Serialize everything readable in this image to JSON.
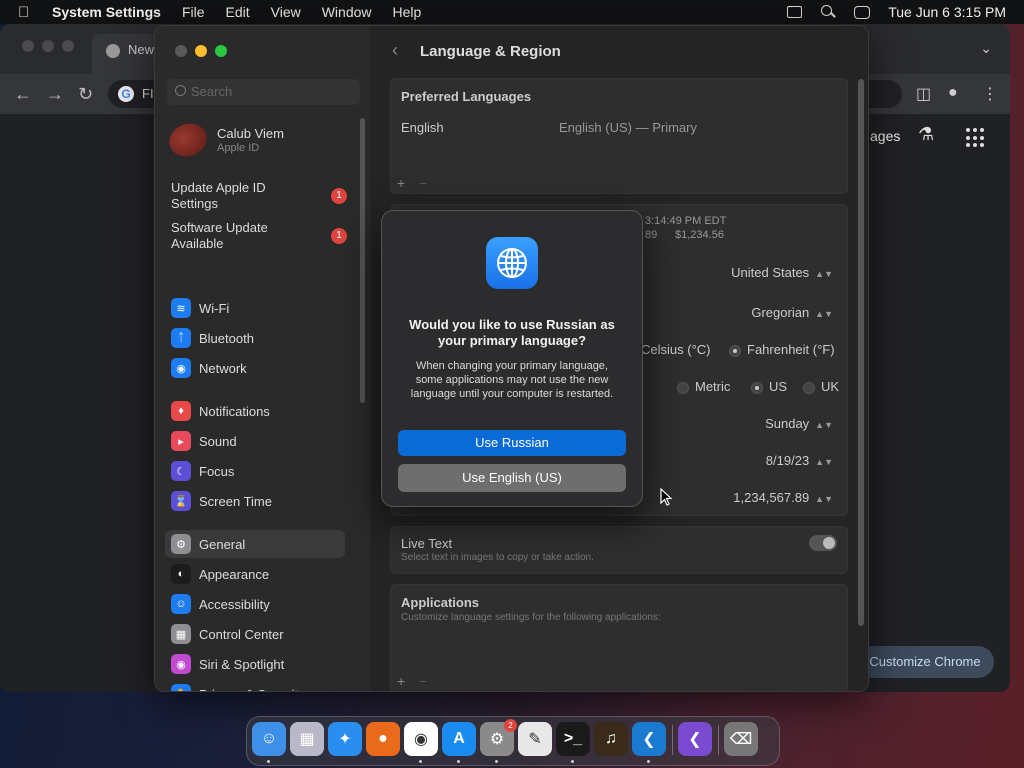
{
  "menubar": {
    "app_name": "System Settings",
    "menus": [
      "File",
      "Edit",
      "View",
      "Window",
      "Help"
    ],
    "clock": "Tue Jun 6  3:15 PM"
  },
  "chrome": {
    "tab_title": "New",
    "omnibox_text": "FI",
    "partial_link": "ages",
    "customize_label": "Customize Chrome"
  },
  "settings": {
    "search_placeholder": "Search",
    "user": {
      "name": "Calub Viem",
      "subtitle": "Apple ID"
    },
    "alerts": [
      {
        "label": "Update Apple ID Settings",
        "count": "1"
      },
      {
        "label": "Software Update Available",
        "count": "1"
      }
    ],
    "sidebar_items": [
      {
        "label": "Wi-Fi",
        "icon": "wifi-icon",
        "color": "#1e7cf2"
      },
      {
        "label": "Bluetooth",
        "icon": "bluetooth-icon",
        "color": "#1e7cf2"
      },
      {
        "label": "Network",
        "icon": "globe-icon",
        "color": "#1e7cf2"
      },
      {
        "label": "Notifications",
        "icon": "bell-icon",
        "color": "#e84a4a"
      },
      {
        "label": "Sound",
        "icon": "speaker-icon",
        "color": "#e84a5c"
      },
      {
        "label": "Focus",
        "icon": "moon-icon",
        "color": "#5b4fd6"
      },
      {
        "label": "Screen Time",
        "icon": "hourglass-icon",
        "color": "#5b4fd6"
      },
      {
        "label": "General",
        "icon": "gear-icon",
        "color": "#8e8e93"
      },
      {
        "label": "Appearance",
        "icon": "appearance-icon",
        "color": "#1c1c1e"
      },
      {
        "label": "Accessibility",
        "icon": "accessibility-icon",
        "color": "#1e7cf2"
      },
      {
        "label": "Control Center",
        "icon": "control-center-icon",
        "color": "#8e8e93"
      },
      {
        "label": "Siri & Spotlight",
        "icon": "siri-icon",
        "color": "#c04ad0"
      },
      {
        "label": "Privacy & Security",
        "icon": "hand-icon",
        "color": "#1e7cf2"
      }
    ],
    "selected_item": "General",
    "page_title": "Language & Region",
    "preferred_languages": {
      "heading": "Preferred Languages",
      "language": "English",
      "value": "English (US) — Primary",
      "add": "+",
      "remove": "−"
    },
    "format_preview": {
      "time": "3:14:49 PM EDT",
      "numbers": "89",
      "currency": "$1,234.56"
    },
    "formats": {
      "region": "United States",
      "calendar": "Gregorian",
      "temp_celsius": "Celsius (°C)",
      "temp_fahrenheit": "Fahrenheit (°F)",
      "measure_metric": "Metric",
      "measure_us": "US",
      "measure_uk": "UK",
      "first_day": "Sunday",
      "date_format": "8/19/23",
      "number_format": "1,234,567.89"
    },
    "live_text": {
      "label": "Live Text",
      "description": "Select text in images to copy or take action."
    },
    "applications": {
      "heading": "Applications",
      "description": "Customize language settings for the following applications:",
      "add": "+",
      "remove": "−"
    }
  },
  "dialog": {
    "title": "Would you like to use Russian as your primary language?",
    "body": "When changing your primary language, some applications may not use the new language until your computer is restarted.",
    "primary_button": "Use Russian",
    "secondary_button": "Use English (US)"
  },
  "dock": {
    "apps": [
      {
        "name": "finder-icon",
        "color": "#3d8fe8",
        "running": true
      },
      {
        "name": "launchpad-icon",
        "color": "#b8b8c8",
        "running": false
      },
      {
        "name": "safari-icon",
        "color": "#2a8ef0",
        "running": false
      },
      {
        "name": "firefox-icon",
        "color": "#e86a1a",
        "running": false
      },
      {
        "name": "chrome-icon",
        "color": "#ffffff",
        "running": true
      },
      {
        "name": "app-store-icon",
        "color": "#1a8cf0",
        "running": true
      },
      {
        "name": "system-settings-icon",
        "color": "#8a8a8a",
        "running": true,
        "badge": "2"
      },
      {
        "name": "script-editor-icon",
        "color": "#e8e8e8",
        "running": false
      },
      {
        "name": "terminal-icon",
        "color": "#1a1a1a",
        "running": true
      },
      {
        "name": "instruments-icon",
        "color": "#3a2a1a",
        "running": false
      },
      {
        "name": "vscode-icon",
        "color": "#1a7ad0",
        "running": true
      },
      {
        "name": "visual-studio-icon",
        "color": "#7a4ad0",
        "running": false
      },
      {
        "name": "trash-icon",
        "color": "#777777",
        "running": false
      }
    ]
  }
}
